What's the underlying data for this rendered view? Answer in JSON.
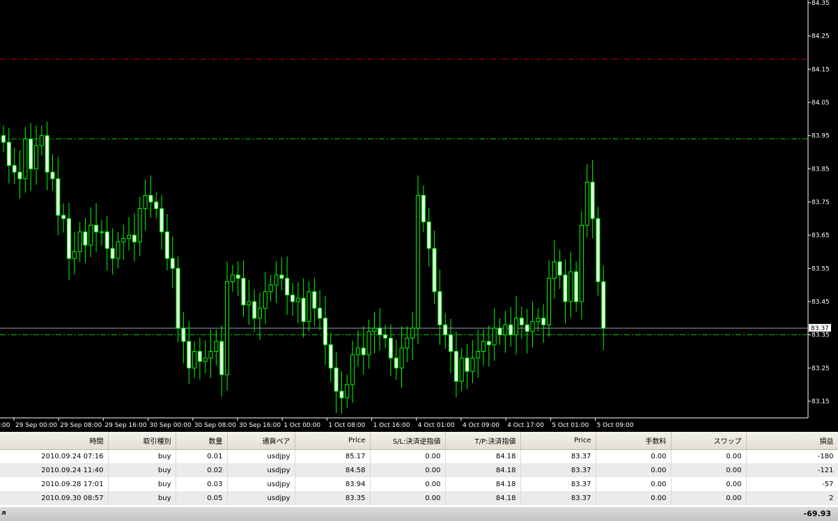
{
  "chart_data": {
    "type": "candlestick",
    "y_ticks": [
      "84.35",
      "84.25",
      "84.15",
      "84.05",
      "83.95",
      "83.85",
      "83.75",
      "83.65",
      "83.55",
      "83.45",
      "83.35",
      "83.25",
      "83.15"
    ],
    "ylim": [
      83.1,
      84.35
    ],
    "x_ticks": [
      "29 Sep 00:00",
      "29 Sep 08:00",
      "29 Sep 16:00",
      "30 Sep 00:00",
      "30 Sep 08:00",
      "30 Sep 16:00",
      "1 Oct 00:00",
      "1 Oct 08:00",
      "1 Oct 16:00",
      "4 Oct 01:00",
      "4 Oct 09:00",
      "4 Oct 17:00",
      "5 Oct 01:00",
      "5 Oct 09:00"
    ],
    "x_tick_partial": ":00",
    "current_price": "83.37",
    "take_profit_level": 84.18,
    "entry_level": 83.94,
    "stop_level": 83.35,
    "colors": {
      "background": "#000000",
      "candle": "#00ff00",
      "tp_line": "#cc0000",
      "level_line": "#00cc00",
      "price_line": "#9aa0b4"
    },
    "closes": [
      83.93,
      83.86,
      83.84,
      83.82,
      83.94,
      83.85,
      83.92,
      83.95,
      83.84,
      83.82,
      83.71,
      83.7,
      83.58,
      83.6,
      83.66,
      83.62,
      83.68,
      83.66,
      83.66,
      83.61,
      83.58,
      83.63,
      83.64,
      83.65,
      83.63,
      83.73,
      83.77,
      83.75,
      83.73,
      83.66,
      83.58,
      83.55,
      83.37,
      83.33,
      83.25,
      83.3,
      83.27,
      83.28,
      83.3,
      83.33,
      83.23,
      83.51,
      83.53,
      83.52,
      83.44,
      83.45,
      83.4,
      83.43,
      83.48,
      83.5,
      83.53,
      83.52,
      83.47,
      83.45,
      83.46,
      83.39,
      83.48,
      83.43,
      83.4,
      83.32,
      83.25,
      83.18,
      83.16,
      83.2,
      83.29,
      83.31,
      83.29,
      83.36,
      83.37,
      83.35,
      83.34,
      83.28,
      83.25,
      83.31,
      83.34,
      83.37,
      83.77,
      83.69,
      83.61,
      83.48,
      83.38,
      83.35,
      83.3,
      83.21,
      83.28,
      83.24,
      83.28,
      83.3,
      83.33,
      83.32,
      83.37,
      83.35,
      83.38,
      83.35,
      83.4,
      83.38,
      83.36,
      83.39,
      83.4,
      83.38,
      83.52,
      83.57,
      83.53,
      83.45,
      83.54,
      83.45,
      83.68,
      83.81,
      83.7,
      83.51,
      83.37
    ],
    "tick_x_positions_ignore": null
  },
  "terminal": {
    "columns": [
      "時間",
      "取引種別",
      "数量",
      "通貨ペア",
      "Price",
      "S/L:決済逆指値",
      "T/P:決済指値",
      "Price",
      "手数料",
      "スワップ",
      "損益"
    ],
    "rows": [
      [
        "2010.09.24 07:16",
        "buy",
        "0.01",
        "usdjpy",
        "85.17",
        "0.00",
        "84.18",
        "83.37",
        "0.00",
        "0.00",
        "-180"
      ],
      [
        "2010.09.24 11:40",
        "buy",
        "0.02",
        "usdjpy",
        "84.58",
        "0.00",
        "84.18",
        "83.37",
        "0.00",
        "0.00",
        "-121"
      ],
      [
        "2010.09.28 17:01",
        "buy",
        "0.03",
        "usdjpy",
        "83.94",
        "0.00",
        "84.18",
        "83.37",
        "0.00",
        "0.00",
        "-57"
      ],
      [
        "2010.09.30 08:57",
        "buy",
        "0.05",
        "usdjpy",
        "83.35",
        "0.00",
        "84.18",
        "83.37",
        "0.00",
        "0.00",
        "2"
      ]
    ],
    "balance_left": "л",
    "balance_right": "-69.93"
  }
}
